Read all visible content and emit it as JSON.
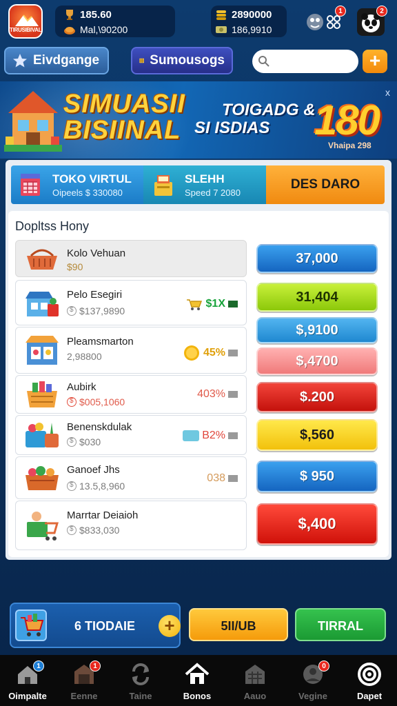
{
  "app": {
    "logo_text": "TIRUSIBIVAL"
  },
  "top_stats": {
    "stat1": "185.60",
    "stat2": "Mal,\\90200",
    "stat3": "2890000",
    "stat4": "186,9910",
    "badge1": "1",
    "badge2": "2"
  },
  "header": {
    "favorites_label": "Eivdgange",
    "shop_label": "Sumousogs",
    "search_placeholder": "",
    "add_label": "+"
  },
  "banner": {
    "title_line1": "SIMUASII",
    "title_line2": "BISIINAL",
    "sub_line1": "TOIGADG &",
    "sub_line2": "SI ISDIAS",
    "big_number": "180",
    "small_text": "Vhaipa 298",
    "close_label": "x"
  },
  "tabs": [
    {
      "title": "TOKO VIRTUL",
      "subtitle": "Oipeels $ 330080"
    },
    {
      "title": "SLEHH",
      "subtitle": "Speed 7 2080"
    },
    {
      "title": "DES DARO"
    }
  ],
  "list": {
    "title": "Dopltss Hony",
    "items": [
      {
        "name": "Kolo Vehuan",
        "price": "$90",
        "pct": "",
        "price_button": "37,000",
        "button_color": "#1e7fd6"
      },
      {
        "name": "Pelo Esegiri",
        "price": "$137,9890",
        "pct": "$1X",
        "price_button": "31,404",
        "button_color": "#a8e20f"
      },
      {
        "name": "Pleamsmarton",
        "price": "2,98800",
        "pct": "45%",
        "price_button": "$,9100",
        "button_color": "#2f9be0"
      },
      {
        "name": "Aubirk",
        "price": "$005,1060",
        "pct": "403%",
        "price_button": "$,4700",
        "button_color": "#f58a8a"
      },
      {
        "name": "Benenskdulak",
        "price": "$030",
        "pct": "B2%",
        "price_button": "$.200",
        "button_color": "#e0231a"
      },
      {
        "name": "Ganoef Jhs",
        "price": "13.5,8,960",
        "pct": "038",
        "price_button": "$,560",
        "button_color": "#f5d90f"
      },
      {
        "name": "Marrtar Deiaioh",
        "price": "$833,030",
        "pct": "",
        "price_button": "$ 950",
        "button_color": "#1a78d2"
      },
      {
        "name": "",
        "price": "",
        "pct": "",
        "price_button": "$,400",
        "button_color": "#e61f18"
      }
    ],
    "pct_colors": [
      "",
      "#17a33a",
      "#e0a00b",
      "#e05a4a",
      "#e0453a",
      "#d49a5a",
      "",
      ""
    ]
  },
  "bottom_actions": {
    "cart_label": "6 TIODAIE",
    "plus_label": "+",
    "buy_label": "5II/UB",
    "trade_label": "TIRRAL"
  },
  "nav": {
    "items": [
      {
        "label": "Oimpalte",
        "icon": "home-icon",
        "badge": "1"
      },
      {
        "label": "Eenne",
        "icon": "shop-icon",
        "badge": "1"
      },
      {
        "label": "Taine",
        "icon": "exchange-icon",
        "badge": ""
      },
      {
        "label": "Bonos",
        "icon": "house-icon",
        "badge": ""
      },
      {
        "label": "Aauo",
        "icon": "store-icon",
        "badge": ""
      },
      {
        "label": "Vegine",
        "icon": "profile-icon",
        "badge": "0"
      },
      {
        "label": "Dapet",
        "icon": "target-icon",
        "badge": ""
      }
    ]
  },
  "colors": {
    "background": "#0b2f5a",
    "accent_orange": "#f59b0b",
    "accent_green": "#1b9a33",
    "accent_blue": "#1e7fd6"
  }
}
